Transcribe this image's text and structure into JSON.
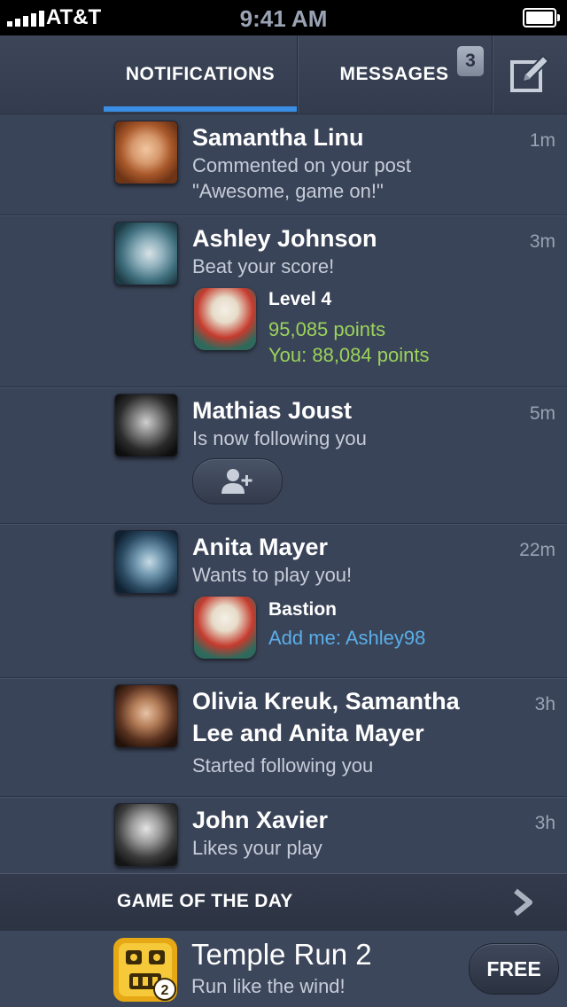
{
  "status_bar": {
    "carrier": "AT&T",
    "time": "9:41 AM"
  },
  "nav": {
    "tabs": [
      {
        "label": "NOTIFICATIONS",
        "selected": true
      },
      {
        "label": "MESSAGES",
        "badge": "3"
      }
    ],
    "compose_icon": "compose-icon"
  },
  "notifications": [
    {
      "name": "Samantha Linu",
      "time": "1m",
      "line1": "Commented on your post",
      "line2": "\"Awesome, game on!\""
    },
    {
      "name": "Ashley Johnson",
      "time": "3m",
      "line1": "Beat your score!",
      "game_title": "Level 4",
      "detail1": "95,085 points",
      "detail2": "You: 88,084 points"
    },
    {
      "name": "Mathias Joust",
      "time": "5m",
      "line1": "Is now following you",
      "action_icon": "add-user-icon"
    },
    {
      "name": "Anita Mayer",
      "time": "22m",
      "line1": "Wants to play you!",
      "game_title": "Bastion",
      "detail1": "Add me: Ashley98"
    },
    {
      "name_line1": "Olivia Kreuk, Samantha",
      "name_line2": "Lee and Anita Mayer",
      "time": "3h",
      "line1": "Started following you"
    },
    {
      "name": "John Xavier",
      "time": "3h",
      "line1": "Likes your play"
    }
  ],
  "game_of_the_day": {
    "header": "GAME OF THE DAY",
    "title": "Temple Run 2",
    "description": "Run like the wind!",
    "price_button": "FREE"
  },
  "colors": {
    "accent": "#3a8ee3",
    "points_green": "#9bd35a",
    "link_blue": "#5aaee8",
    "background": "#3a4458"
  }
}
